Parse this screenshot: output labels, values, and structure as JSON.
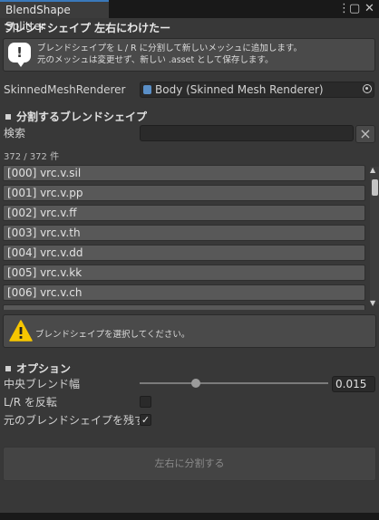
{
  "window": {
    "tab_title": "BlendShape Splitter",
    "menu_icon": "kebab-menu-icon",
    "close_icon": "close-icon"
  },
  "header": {
    "title": "ブレンドシェイプ 左右にわけたー"
  },
  "info": {
    "icon": "speech-bubble-exclamation-icon",
    "line1": "ブレンドシェイプを L / R に分割して新しいメッシュに追加します。",
    "line2": "元のメッシュは変更せず、新しい .asset として保存します。"
  },
  "renderer": {
    "label": "SkinnedMeshRenderer",
    "value": "Body (Skinned Mesh Renderer)"
  },
  "blendshapes_section": {
    "title": "分割するブレンドシェイプ",
    "search_label": "検索",
    "search_value": "",
    "clear_symbol": "×",
    "count": "372 / 372 件",
    "items": [
      "[000]  vrc.v.sil",
      "[001]  vrc.v.pp",
      "[002]  vrc.v.ff",
      "[003]  vrc.v.th",
      "[004]  vrc.v.dd",
      "[005]  vrc.v.kk",
      "[006]  vrc.v.ch"
    ]
  },
  "warning": {
    "icon": "warning-triangle-icon",
    "text": "ブレンドシェイプを選択してください。"
  },
  "options": {
    "title": "オプション",
    "blend_width_label": "中央ブレンド幅",
    "blend_width_value": "0.015",
    "blend_width_slider": 0.3,
    "flip_lr_label": "L/R を反転",
    "flip_lr_checked": false,
    "keep_original_label": "元のブレンドシェイプを残す",
    "keep_original_checked": true
  },
  "actions": {
    "split_button": "左右に分割する"
  }
}
